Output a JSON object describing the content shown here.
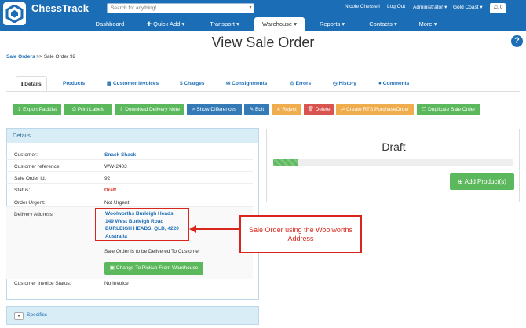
{
  "header": {
    "brand": "ChessTrack",
    "search_placeholder": "Search for anything!",
    "user": "Nicole Chessell",
    "logout": "Log Out",
    "role": "Administrator",
    "location": "Gold Coast",
    "notifications": "0"
  },
  "nav": {
    "dashboard": "Dashboard",
    "quick_add": "Quick Add",
    "transport": "Transport",
    "warehouse": "Warehouse",
    "reports": "Reports",
    "contacts": "Contacts",
    "more": "More"
  },
  "page": {
    "title": "View Sale Order",
    "breadcrumb_link": "Sale Orders",
    "breadcrumb_current": ">> Sale Order 92"
  },
  "tabs": {
    "details": "Details",
    "products": "Products",
    "invoices": "Customer Invoices",
    "charges": "Charges",
    "consignments": "Consignments",
    "errors": "Errors",
    "history": "History",
    "comments": "Comments"
  },
  "actions": {
    "export": "Export Packlist",
    "print": "Print Labels",
    "download": "Download Delivery Note",
    "differences": "Show Differences",
    "edit": "Edit",
    "reject": "Reject",
    "delete": "Delete",
    "rts": "Create RTS PurchaseOrder",
    "duplicate": "Duplicate Sale Order"
  },
  "details": {
    "heading": "Details",
    "customer_label": "Customer:",
    "customer": "Snack Shack",
    "ref_label": "Customer reference:",
    "ref": "WW-2403",
    "id_label": "Sale Order Id:",
    "id": "92",
    "status_label": "Status:",
    "status": "Draft",
    "urgent_label": "Order Urgent:",
    "urgent": "Not Urgent",
    "delivery_label": "Delivery Address:",
    "addr_line1": "Woolworths Burleigh Heads",
    "addr_line2": "149 West Burleigh Road",
    "addr_line3": "BURLEIGH HEADS, QLD, 4220",
    "addr_line4": "Australia",
    "delivery_note": "Sale Order is to be Delivered To Customer",
    "pickup_button": "Change To Pickup From Warehouse",
    "invoice_label": "Customer Invoice Status:",
    "invoice": "No Invoice"
  },
  "specifics": {
    "label": "Specifics"
  },
  "status_panel": {
    "title": "Draft",
    "progress": 0.1,
    "add_product": "Add Product(s)"
  },
  "annotation": {
    "line1": "Sale Order using the Woolworths",
    "line2": "Address"
  },
  "colors": {
    "primary": "#1b6db5",
    "success": "#5cb85c",
    "warning": "#f0ad4e",
    "danger": "#d9534f",
    "annotation": "#d9261c"
  }
}
